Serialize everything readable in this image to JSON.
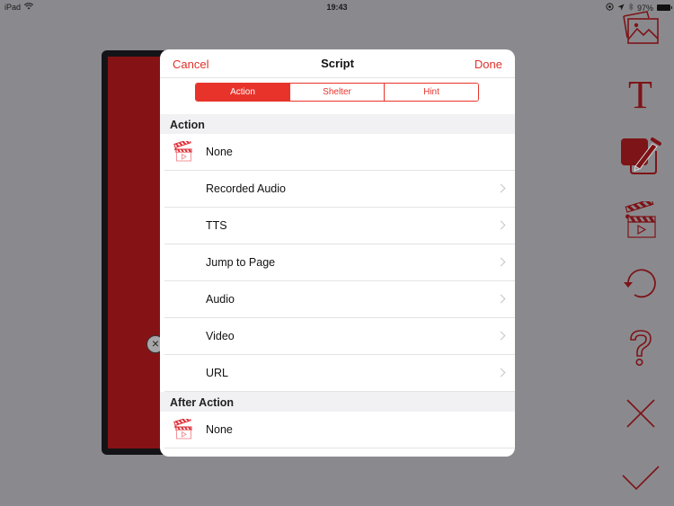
{
  "status_bar": {
    "device": "iPad",
    "time": "19:43",
    "battery": "97%"
  },
  "colors": {
    "accent": "#e8332b",
    "toolbar_icon": "#7d1418",
    "page_fill": "#851315",
    "backdrop": "#8a8a8e"
  },
  "page_preview": {
    "close_icon": "×"
  },
  "modal": {
    "cancel_label": "Cancel",
    "title": "Script",
    "done_label": "Done",
    "tabs": [
      {
        "label": "Action",
        "active": true
      },
      {
        "label": "Shelter",
        "active": false
      },
      {
        "label": "Hint",
        "active": false
      }
    ],
    "sections": [
      {
        "header": "Action",
        "rows": [
          {
            "label": "None",
            "icon": "clapperboard-icon",
            "chevron": false
          },
          {
            "label": "Recorded Audio",
            "chevron": true
          },
          {
            "label": "TTS",
            "chevron": true
          },
          {
            "label": "Jump to Page",
            "chevron": true
          },
          {
            "label": "Audio",
            "chevron": true
          },
          {
            "label": "Video",
            "chevron": true
          },
          {
            "label": "URL",
            "chevron": true
          }
        ]
      },
      {
        "header": "After Action",
        "rows": [
          {
            "label": "None",
            "icon": "clapperboard-icon",
            "chevron": false
          }
        ]
      }
    ]
  },
  "toolbar": {
    "items": [
      {
        "name": "image-icon"
      },
      {
        "name": "text-icon",
        "glyph": "T"
      },
      {
        "name": "edit-script-icon"
      },
      {
        "name": "clapperboard-icon"
      },
      {
        "name": "undo-icon"
      },
      {
        "name": "help-icon"
      },
      {
        "name": "close-icon"
      },
      {
        "name": "check-icon"
      }
    ]
  }
}
